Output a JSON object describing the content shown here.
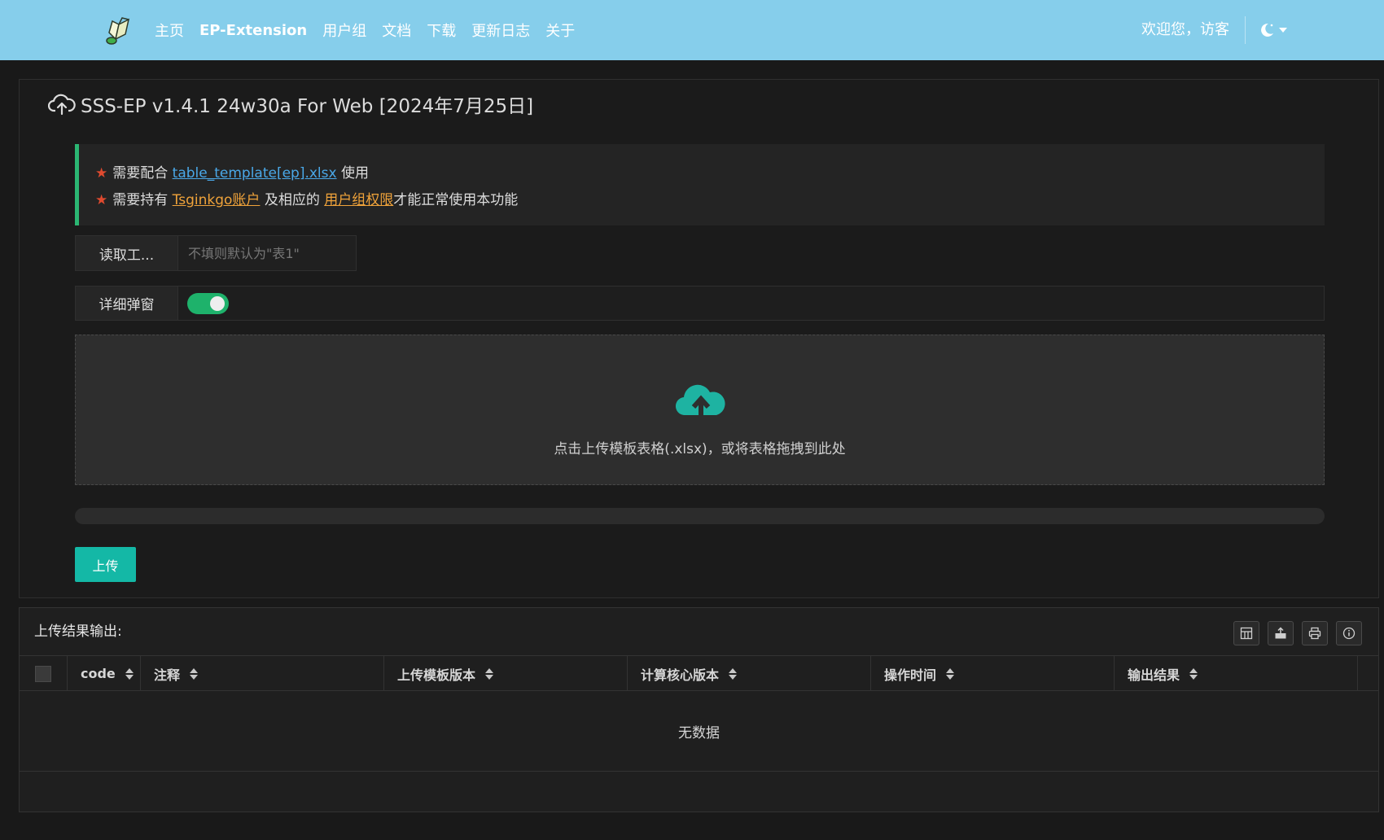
{
  "navbar": {
    "items": [
      {
        "label": "主页",
        "active": false
      },
      {
        "label": "EP-Extension",
        "active": true
      },
      {
        "label": "用户组",
        "active": false
      },
      {
        "label": "文档",
        "active": false
      },
      {
        "label": "下载",
        "active": false
      },
      {
        "label": "更新日志",
        "active": false
      },
      {
        "label": "关于",
        "active": false
      }
    ],
    "welcome": "欢迎您，访客",
    "theme_icon": "moon-icon"
  },
  "panel": {
    "title": "SSS-EP v1.4.1 24w30a For Web [2024年7月25日]",
    "title_icon": "cloud-upload-icon"
  },
  "notice": {
    "line1": {
      "star": "★",
      "before": "需要配合",
      "link": "table_template[ep].xlsx",
      "after": "使用"
    },
    "line2": {
      "star": "★",
      "before": "需要持有",
      "link1": "Tsginkgo账户",
      "middle": "及相应的",
      "link2": "用户组权限",
      "after": "才能正常使用本功能"
    }
  },
  "form": {
    "sheet_label": "读取工...",
    "sheet_placeholder": "不填则默认为\"表1\"",
    "sheet_value": "",
    "popup_label": "详细弹窗",
    "popup_enabled": true
  },
  "dropzone": {
    "icon": "cloud-upload-icon",
    "text": "点击上传模板表格(.xlsx)，或将表格拖拽到此处"
  },
  "progress": {
    "value": 0
  },
  "upload_button": "上传",
  "results": {
    "title": "上传结果输出:",
    "tools": [
      "columns-icon",
      "export-icon",
      "print-icon",
      "info-icon"
    ],
    "columns": [
      "code",
      "注释",
      "上传模板版本",
      "计算核心版本",
      "操作时间",
      "输出结果"
    ],
    "empty_text": "无数据"
  },
  "colors": {
    "navbar": "#86ceeb",
    "accent": "#14b8a6",
    "switch_on": "#1eb26b",
    "notice_border": "#2bb673",
    "link_blue": "#4aa8e8",
    "link_orange": "#f0a33a",
    "star": "#e04a2f"
  }
}
